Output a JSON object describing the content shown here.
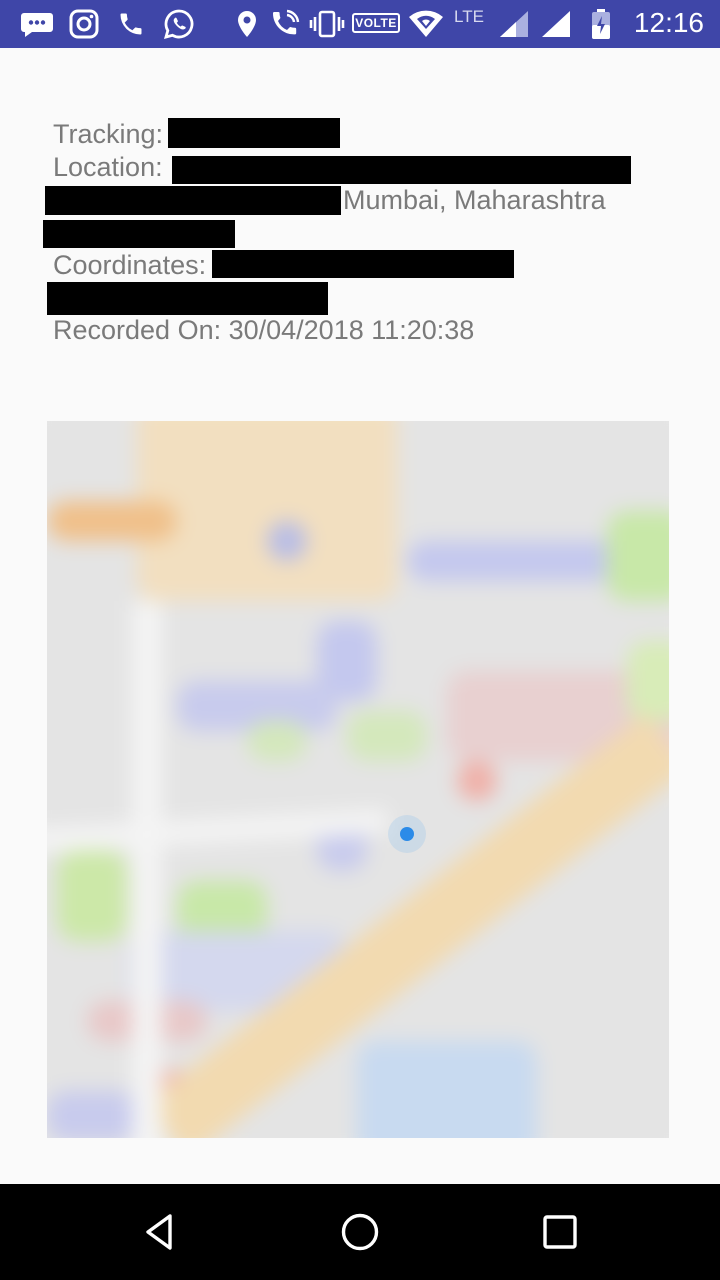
{
  "status_bar": {
    "time": "12:16",
    "volte_label": "VOLTE",
    "network_type": "LTE",
    "icons": [
      "message-icon",
      "instagram-icon",
      "phone-icon",
      "whatsapp-icon",
      "location-icon",
      "wifi-calling-icon",
      "vibrate-icon",
      "volte-icon",
      "wifi-icon",
      "signal-icon",
      "signal-icon-2",
      "battery-icon"
    ]
  },
  "details": {
    "tracking_label": "Tracking:",
    "location_label": "Location:",
    "location_visible_text": "Mumbai, Maharashtra",
    "coordinates_label": "Coordinates:",
    "recorded_on_text": "Recorded On: 30/04/2018 11:20:38"
  },
  "colors": {
    "status_bar": "#3f46a8",
    "background": "#fafafa",
    "text": "#7a7a7a",
    "location_dot": "#2b8be8",
    "navbar": "#000000"
  },
  "navigation": {
    "buttons": [
      "back-icon",
      "home-icon",
      "recents-icon"
    ]
  }
}
